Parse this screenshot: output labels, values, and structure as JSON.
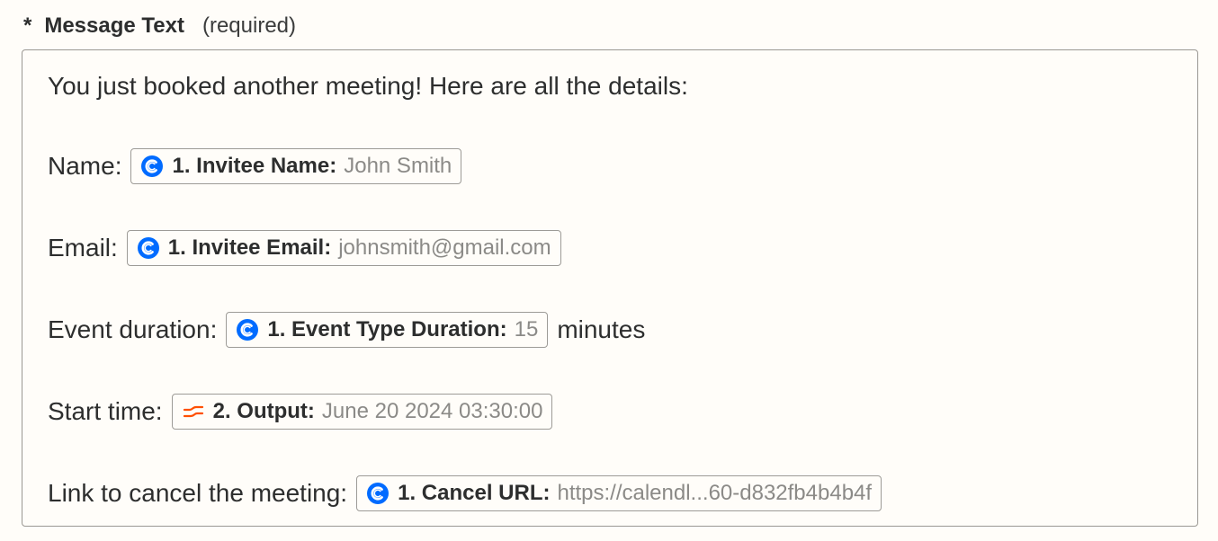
{
  "field": {
    "required_marker": "*",
    "label": "Message Text",
    "required_note": "(required)"
  },
  "message": {
    "intro": "You just booked another meeting! Here are all the details:",
    "lines": [
      {
        "prefix": "Name:",
        "pill": {
          "icon": "calendly-icon",
          "key": "1. Invitee Name:",
          "value": "John Smith"
        },
        "suffix": ""
      },
      {
        "prefix": "Email:",
        "pill": {
          "icon": "calendly-icon",
          "key": "1. Invitee Email:",
          "value": "johnsmith@gmail.com"
        },
        "suffix": ""
      },
      {
        "prefix": "Event duration:",
        "pill": {
          "icon": "calendly-icon",
          "key": "1. Event Type Duration:",
          "value": "15"
        },
        "suffix": "minutes"
      },
      {
        "prefix": "Start time:",
        "pill": {
          "icon": "formatter-icon",
          "key": "2. Output:",
          "value": "June 20 2024 03:30:00"
        },
        "suffix": ""
      },
      {
        "prefix": "Link to cancel the meeting:",
        "pill": {
          "icon": "calendly-icon",
          "key": "1. Cancel URL:",
          "value": "https://calendl...60-d832fb4b4b4f"
        },
        "suffix": ""
      }
    ]
  },
  "colors": {
    "calendly_blue": "#006bff",
    "formatter_orange": "#ff4f00",
    "pill_value_gray": "#8b8a87",
    "text": "#2d2e2e",
    "background": "#fffdf9"
  }
}
